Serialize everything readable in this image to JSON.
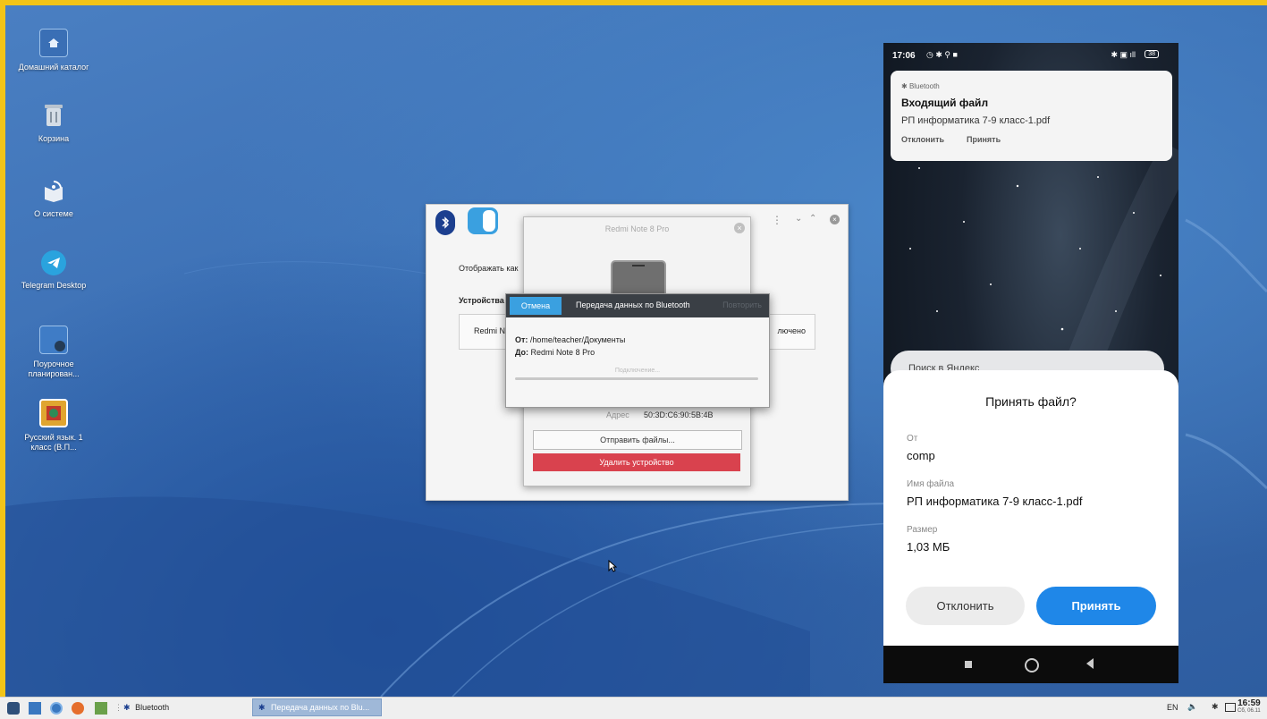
{
  "desktop_icons": [
    {
      "label": "Домашний каталог",
      "icon": "home-folder-icon"
    },
    {
      "label": "Корзина",
      "icon": "trash-icon"
    },
    {
      "label": "О системе",
      "icon": "about-system-icon"
    },
    {
      "label": "Telegram Desktop",
      "icon": "telegram-icon"
    },
    {
      "label": "Поурочное планирован...",
      "icon": "folder-link-icon"
    },
    {
      "label": "Русский язык. 1 класс (В.П...",
      "icon": "book-app-icon"
    }
  ],
  "bt_window": {
    "show_as_label": "Отображать как",
    "devices_header": "Устройства",
    "device_row_name": "Redmi N",
    "device_row_status": "лючено"
  },
  "device_dialog": {
    "title": "Redmi Note 8 Pro",
    "address_label": "Адрес",
    "address_value": "50:3D:C6:90:5B:4B",
    "send_files": "Отправить файлы...",
    "remove_device": "Удалить устройство"
  },
  "transfer_dialog": {
    "cancel": "Отмена",
    "title": "Передача данных по Bluetooth",
    "right_faded": "Повторить",
    "from_label": "От:",
    "from_value": "/home/teacher/Документы",
    "to_label": "До:",
    "to_value": "Redmi Note 8 Pro",
    "status": "Подключение...",
    "progress": 0
  },
  "phone": {
    "time": "17:06",
    "battery": "38",
    "notification": {
      "app": "Bluetooth",
      "title": "Входящий файл",
      "body": "РП информатика 7-9 класс-1.pdf",
      "reject": "Отклонить",
      "accept": "Принять"
    },
    "search_placeholder": "Поиск в Яндекс",
    "sheet": {
      "title": "Принять файл?",
      "from_label": "От",
      "from_value": "comp",
      "name_label": "Имя файла",
      "name_value": "РП информатика 7-9 класс-1.pdf",
      "size_label": "Размер",
      "size_value": "1,03 МБ",
      "reject": "Отклонить",
      "accept": "Принять"
    }
  },
  "taskbar": {
    "bluetooth_label": "Bluetooth",
    "active_task": "Передача данных по Blu...",
    "lang": "EN",
    "clock_time": "16:59",
    "clock_date": "Сб, 06.11"
  },
  "colors": {
    "accent_blue": "#3aa0e0",
    "danger_red": "#d9424e",
    "phone_accept": "#1f87e8"
  }
}
